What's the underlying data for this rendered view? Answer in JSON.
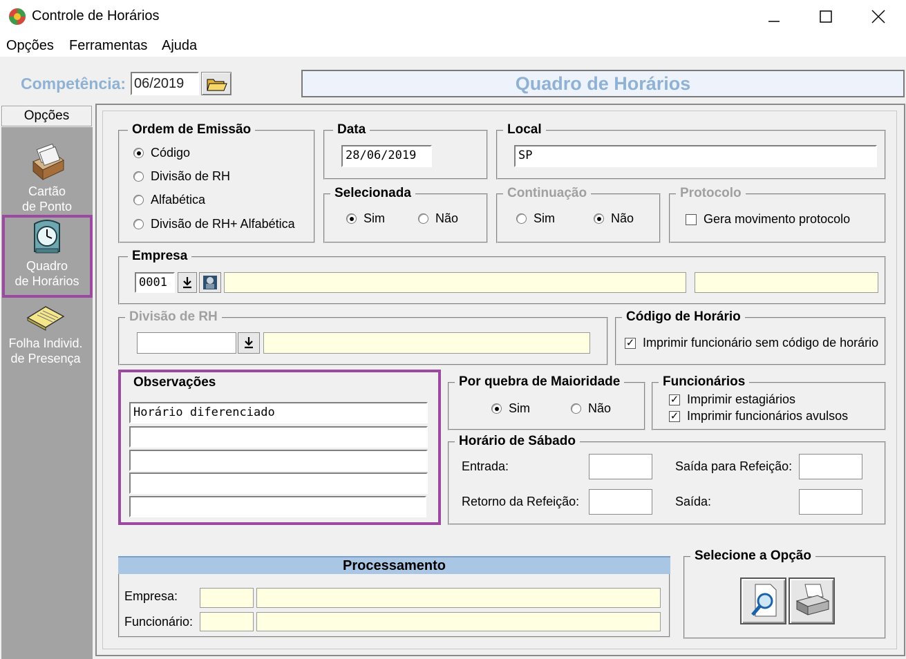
{
  "window": {
    "title": "Controle de Horários",
    "controls": {
      "minimize": "—",
      "maximize": "☐",
      "close": "✕"
    }
  },
  "menu": [
    "Opções",
    "Ferramentas",
    "Ajuda"
  ],
  "header": {
    "competencia_label": "Competência:",
    "competencia_value": "06/2019",
    "screen_title": "Quadro de Horários"
  },
  "sidebar": {
    "tab_label": "Opções",
    "items": [
      {
        "line1": "Cartão",
        "line2": "de Ponto",
        "icon": "card-file-icon"
      },
      {
        "line1": "Quadro",
        "line2": "de Horários",
        "icon": "clock-icon"
      },
      {
        "line1": "Folha Individ.",
        "line2": "de Presença",
        "icon": "sheet-icon"
      }
    ]
  },
  "ordem": {
    "title": "Ordem de Emissão",
    "options": [
      "Código",
      "Divisão de RH",
      "Alfabética",
      "Divisão de RH+ Alfabética"
    ],
    "selected": 0
  },
  "data": {
    "title": "Data",
    "value": "28/06/2019"
  },
  "local": {
    "title": "Local",
    "value": "SP"
  },
  "selecionada": {
    "title": "Selecionada",
    "sim": "Sim",
    "nao": "Não",
    "selected": "sim"
  },
  "continuacao": {
    "title": "Continuação",
    "sim": "Sim",
    "nao": "Não",
    "selected": "nao"
  },
  "protocolo": {
    "title": "Protocolo",
    "check_label": "Gera movimento protocolo",
    "checked": false
  },
  "empresa": {
    "title": "Empresa",
    "code": "0001",
    "name": "",
    "extra": ""
  },
  "divisao": {
    "title": "Divisão de RH",
    "code": "",
    "name": ""
  },
  "codigo_horario": {
    "title": "Código de Horário",
    "check_label": "Imprimir funcionário sem código de horário",
    "checked": true
  },
  "observacoes": {
    "title": "Observações",
    "lines": [
      "Horário diferenciado",
      "",
      "",
      "",
      ""
    ]
  },
  "maioridade": {
    "title": "Por quebra de  Maioridade",
    "sim": "Sim",
    "nao": "Não",
    "selected": "sim"
  },
  "funcionarios": {
    "title": "Funcionários",
    "checks": [
      {
        "label": "Imprimir estagiários",
        "checked": true
      },
      {
        "label": "Imprimir funcionários avulsos",
        "checked": true
      }
    ]
  },
  "sabado": {
    "title": "Horário de Sábado",
    "entrada": "Entrada:",
    "saida_refeicao": "Saída para Refeição:",
    "retorno_refeicao": "Retorno da Refeição:",
    "saida": "Saída:"
  },
  "processamento": {
    "title": "Processamento",
    "empresa_label": "Empresa:",
    "funcionario_label": "Funcionário:"
  },
  "selecione": {
    "title": "Selecione a Opção"
  }
}
